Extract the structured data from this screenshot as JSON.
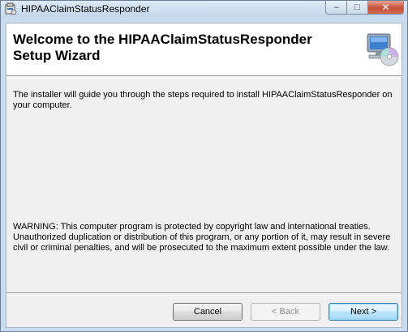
{
  "window": {
    "title": "HIPAAClaimStatusResponder",
    "icon": "installer-package-icon",
    "caption_buttons": {
      "minimize": "–",
      "maximize": "□",
      "close": "✕"
    }
  },
  "banner": {
    "title": "Welcome to the HIPAAClaimStatusResponder Setup Wizard",
    "icon": "computer-cd-icon"
  },
  "body": {
    "intro": "The installer will guide you through the steps required to install HIPAAClaimStatusResponder on your computer.",
    "warning": "WARNING: This computer program is protected by copyright law and international treaties. Unauthorized duplication or distribution of this program, or any portion of it, may result in severe civil or criminal penalties, and will be prosecuted to the maximum extent possible under the law."
  },
  "buttons": {
    "cancel": "Cancel",
    "back": "< Back",
    "next": "Next >"
  },
  "colors": {
    "close_button": "#c8503a",
    "dialog_background": "#f0f0f0",
    "default_button_border": "#3c7fb1"
  }
}
